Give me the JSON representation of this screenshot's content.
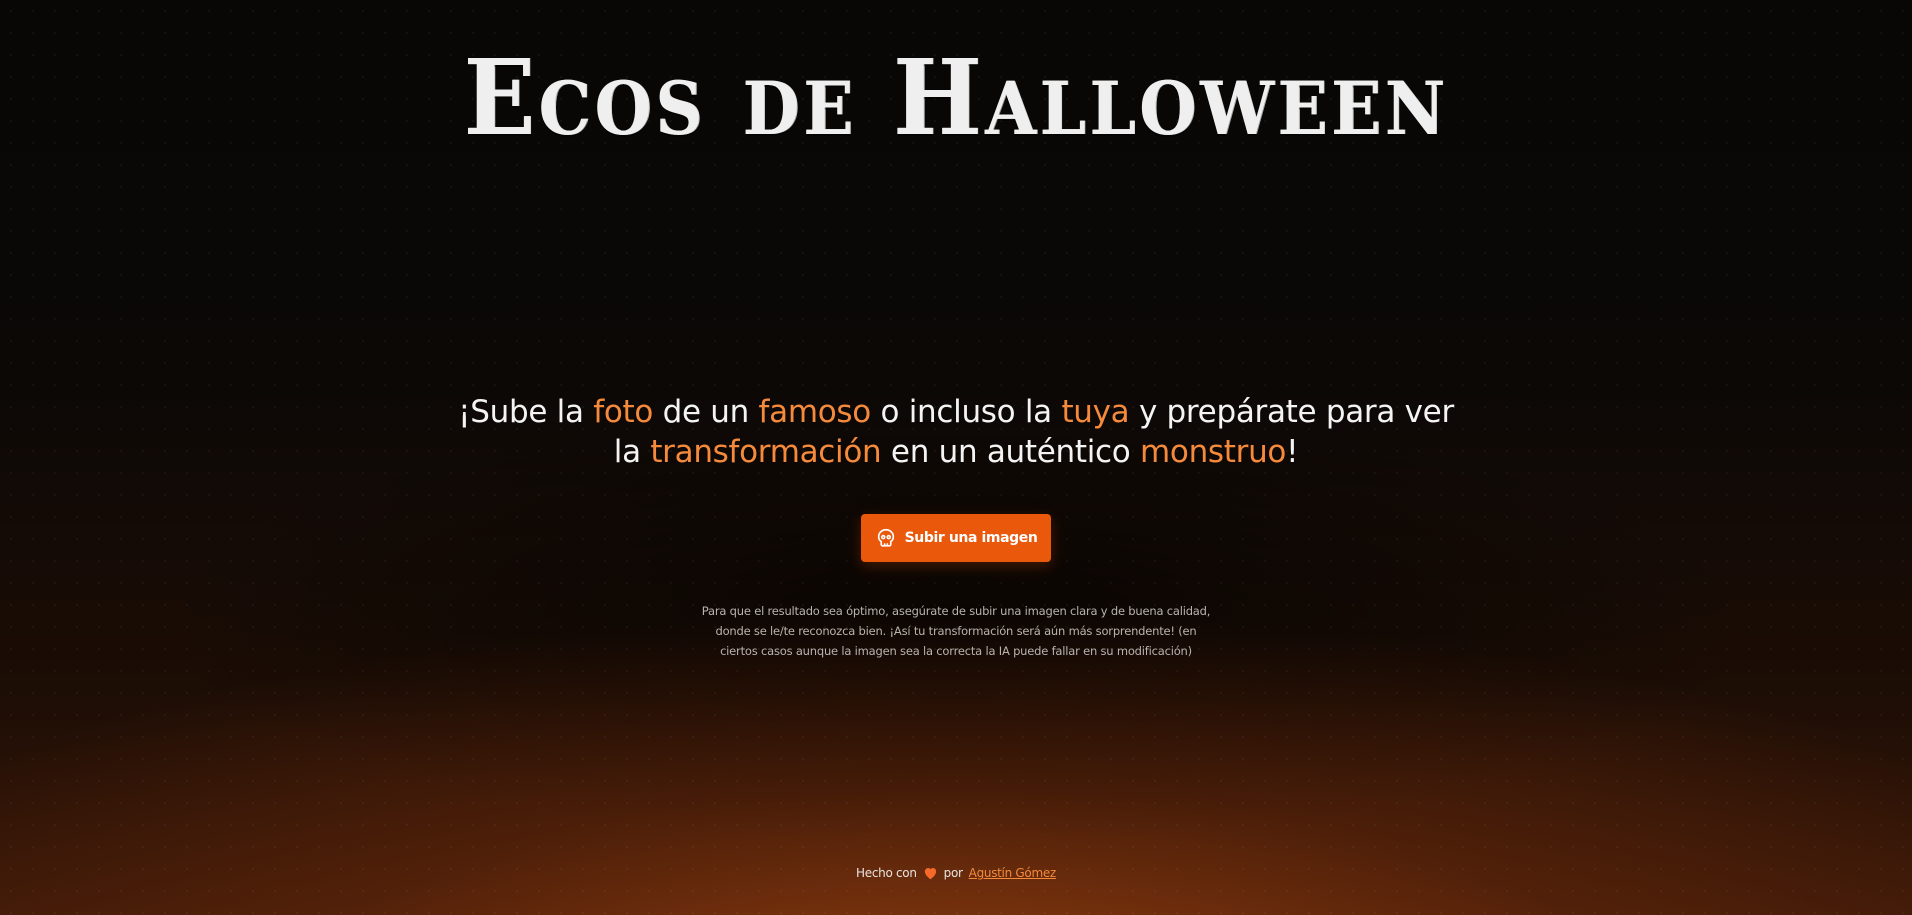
{
  "header": {
    "title": "Ecos de Halloween"
  },
  "hero": {
    "tagline": [
      {
        "text": "¡Sube la ",
        "accent": false
      },
      {
        "text": "foto",
        "accent": true
      },
      {
        "text": " de un ",
        "accent": false
      },
      {
        "text": "famoso",
        "accent": true
      },
      {
        "text": " o incluso la ",
        "accent": false
      },
      {
        "text": "tuya",
        "accent": true
      },
      {
        "text": " y prepárate para ver la ",
        "accent": false
      },
      {
        "text": "transformación",
        "accent": true
      },
      {
        "text": " en un auténtico ",
        "accent": false
      },
      {
        "text": "monstruo",
        "accent": true
      },
      {
        "text": "!",
        "accent": false
      }
    ],
    "upload_button_label": "Subir una imagen",
    "upload_button_icon": "skull-icon",
    "notice": "Para que el resultado sea óptimo, asegúrate de subir una imagen clara y de buena calidad, donde se le/te reconozca bien. ¡Así tu transformación será aún más sorprendente! (en ciertos casos aunque la imagen sea la correcta la IA puede fallar en su modificación)"
  },
  "footer": {
    "prefix": "Hecho con",
    "icon": "heart-icon",
    "by": "por",
    "author_link": "Agustín Gómez"
  },
  "colors": {
    "accent": "#f58a3c",
    "button": "#ea580c",
    "background": "#060504",
    "title": "#efefef"
  }
}
